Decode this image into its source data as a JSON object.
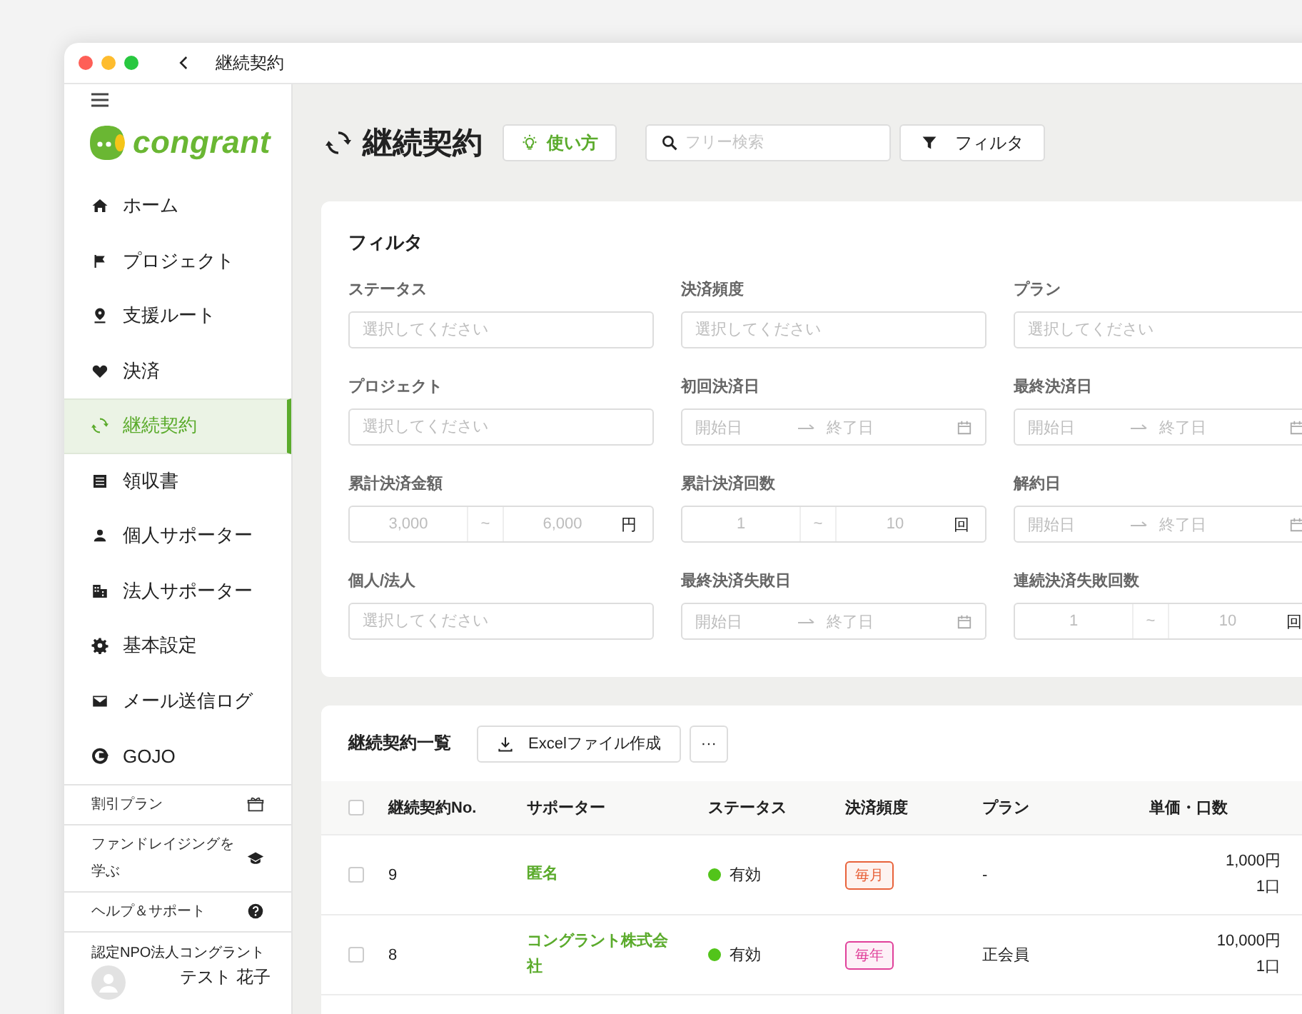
{
  "window": {
    "title": "継続契約"
  },
  "sidebar": {
    "logo_text": "congrant",
    "items": [
      {
        "label": "ホーム",
        "selected": false
      },
      {
        "label": "プロジェクト",
        "selected": false
      },
      {
        "label": "支援ルート",
        "selected": false
      },
      {
        "label": "決済",
        "selected": false
      },
      {
        "label": "継続契約",
        "selected": true
      },
      {
        "label": "領収書",
        "selected": false
      },
      {
        "label": "個人サポーター",
        "selected": false
      },
      {
        "label": "法人サポーター",
        "selected": false
      },
      {
        "label": "基本設定",
        "selected": false
      },
      {
        "label": "メール送信ログ",
        "selected": false
      },
      {
        "label": "GOJO",
        "selected": false
      }
    ],
    "links": [
      {
        "label": "割引プラン"
      },
      {
        "label": "ファンドレイジングを学ぶ"
      },
      {
        "label": "ヘルプ＆サポート"
      }
    ],
    "organization": "認定NPO法人コングラント",
    "user_name": "テスト 花子"
  },
  "header": {
    "title": "継続契約",
    "help_button": "使い方",
    "search": {
      "placeholder": "フリー検索"
    },
    "filter_button": "フィルタ"
  },
  "filter_panel": {
    "title": "フィルタ",
    "fields": [
      {
        "kind": "select",
        "label": "ステータス",
        "placeholder": "選択してください"
      },
      {
        "kind": "select",
        "label": "決済頻度",
        "placeholder": "選択してください"
      },
      {
        "kind": "select",
        "label": "プラン",
        "placeholder": "選択してください"
      },
      {
        "kind": "select",
        "label": "プロジェクト",
        "placeholder": "選択してください"
      },
      {
        "kind": "date_range",
        "label": "初回決済日",
        "start_placeholder": "開始日",
        "end_placeholder": "終了日"
      },
      {
        "kind": "date_range",
        "label": "最終決済日",
        "start_placeholder": "開始日",
        "end_placeholder": "終了日"
      },
      {
        "kind": "number_range",
        "label": "累計決済金額",
        "min_placeholder": "3,000",
        "separator": "~",
        "max_placeholder": "6,000",
        "unit": "円"
      },
      {
        "kind": "number_range",
        "label": "累計決済回数",
        "min_placeholder": "1",
        "separator": "~",
        "max_placeholder": "10",
        "unit": "回"
      },
      {
        "kind": "date_range",
        "label": "解約日",
        "start_placeholder": "開始日",
        "end_placeholder": "終了日"
      },
      {
        "kind": "select",
        "label": "個人/法人",
        "placeholder": "選択してください"
      },
      {
        "kind": "date_range",
        "label": "最終決済失敗日",
        "start_placeholder": "開始日",
        "end_placeholder": "終了日"
      },
      {
        "kind": "number_range",
        "label": "連続決済失敗回数",
        "min_placeholder": "1",
        "separator": "~",
        "max_placeholder": "10",
        "unit": "回"
      }
    ]
  },
  "table": {
    "title": "継続契約一覧",
    "export_button": "Excelファイル作成",
    "more_button": "···",
    "all_checked": false,
    "columns": [
      "継続契約No.",
      "サポーター",
      "ステータス",
      "決済頻度",
      "プラン",
      "単価・口数"
    ],
    "rows": [
      {
        "checked": false,
        "number": "9",
        "supporter": "匿名",
        "status": {
          "text": "有効",
          "color": "#52c41a"
        },
        "frequency": {
          "text": "毎月",
          "color": "#e8623a"
        },
        "plan": "-",
        "price": "1,000円",
        "units": "1口"
      },
      {
        "checked": false,
        "number": "8",
        "supporter": "コングラント株式会社",
        "status": {
          "text": "有効",
          "color": "#52c41a"
        },
        "frequency": {
          "text": "毎年",
          "color": "#e0409a"
        },
        "plan": "正会員",
        "price": "10,000円",
        "units": "1口"
      }
    ]
  }
}
